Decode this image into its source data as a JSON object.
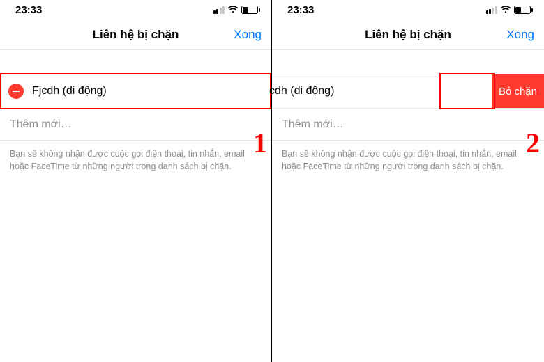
{
  "panes": [
    {
      "status": {
        "time": "23:33"
      },
      "header": {
        "title": "Liên hệ bị chặn",
        "done": "Xong"
      },
      "contact": {
        "name": "Fjcdh (di động)"
      },
      "addNew": "Thêm mới…",
      "footer": "Bạn sẽ không nhận được cuộc gọi điện thoại, tin nhắn, email hoặc FaceTime từ những người trong danh sách bị chặn.",
      "step": "1"
    },
    {
      "status": {
        "time": "23:33"
      },
      "header": {
        "title": "Liên hệ bị chặn",
        "done": "Xong"
      },
      "contact": {
        "name_partial": "cdh (di động)",
        "unblock": "Bỏ chặn"
      },
      "addNew": "Thêm mới…",
      "footer": "Bạn sẽ không nhận được cuộc gọi điện thoại, tin nhắn, email hoặc FaceTime từ những người trong danh sách bị chặn.",
      "step": "2"
    }
  ]
}
